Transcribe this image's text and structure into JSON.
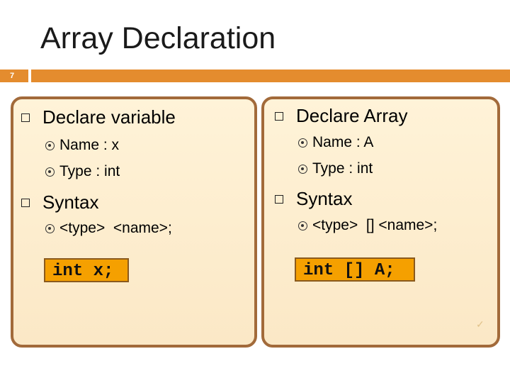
{
  "slide": {
    "title": "Array Declaration",
    "number": "7"
  },
  "left": {
    "heading1": "Declare variable",
    "name_line": "Name : x",
    "type_line": "Type : int",
    "heading2": "Syntax",
    "syntax_line": "<type>  <name>;",
    "code": "int x;"
  },
  "right": {
    "heading1": "Declare Array",
    "name_line": "Name : A",
    "type_line": "Type : int",
    "heading2": "Syntax",
    "syntax_line": "<type>  [] <name>;",
    "code": "int [] A;"
  },
  "colors": {
    "accent": "#e48c2e",
    "panel_border": "#a26a3a",
    "code_fill": "#f5a000"
  }
}
